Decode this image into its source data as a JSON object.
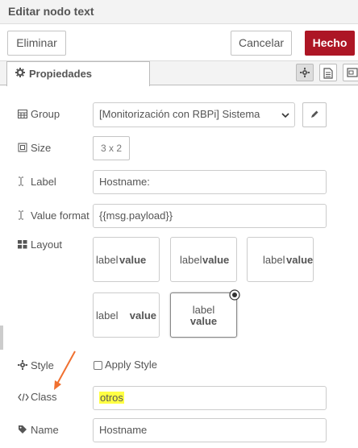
{
  "window": {
    "title": "Editar nodo text"
  },
  "toolbar": {
    "delete_label": "Eliminar",
    "cancel_label": "Cancelar",
    "done_label": "Hecho"
  },
  "tabs": [
    {
      "label": "Propiedades"
    }
  ],
  "form": {
    "group": {
      "label": "Group",
      "value": "[Monitorización con RBPi] Sistema"
    },
    "size": {
      "label": "Size",
      "value": "3 x 2"
    },
    "label": {
      "label": "Label",
      "value": "Hostname:"
    },
    "value_format": {
      "label": "Value format",
      "value": "{{msg.payload}}"
    },
    "layout": {
      "label": "Layout",
      "options": [
        {
          "label": "label",
          "value": "value"
        },
        {
          "label": "label",
          "value": "value"
        },
        {
          "label": "label",
          "value": "value"
        },
        {
          "label": "label",
          "value": "value"
        },
        {
          "label": "label",
          "value": "value"
        }
      ]
    },
    "style": {
      "label": "Style",
      "checkbox_label": "Apply Style",
      "checked": false
    },
    "class": {
      "label": "Class",
      "value": "otros"
    },
    "name": {
      "label": "Name",
      "value": "Hostname"
    }
  },
  "colors": {
    "primary": "#ad1625",
    "highlight": "#ffff44",
    "arrow": "#f07030"
  }
}
